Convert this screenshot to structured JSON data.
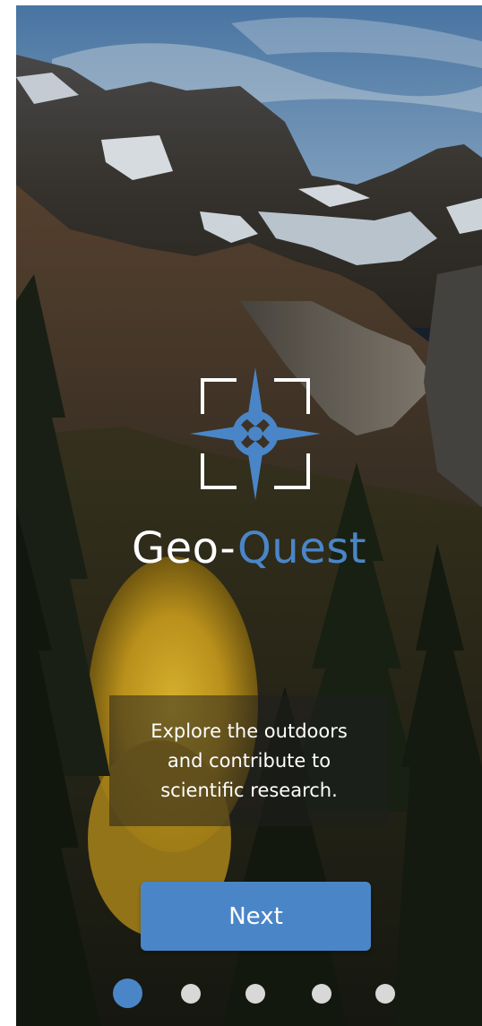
{
  "screen": {
    "background": "mountain-forest-photo",
    "logo_icon": "compass-target-icon",
    "brand": {
      "part1": "Geo-",
      "part2": "Quest"
    },
    "tagline": [
      "Explore the outdoors",
      "and contribute to",
      "scientific research."
    ],
    "next_button_label": "Next",
    "pagination": {
      "current_page": 1,
      "total_pages": 5
    }
  },
  "colors": {
    "accent": "#4a86c7",
    "dot_inactive": "#d8d8d8",
    "text": "#ffffff"
  }
}
